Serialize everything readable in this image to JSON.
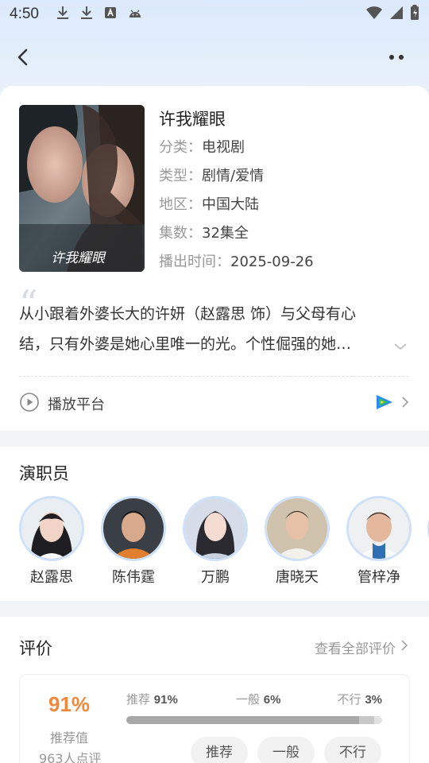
{
  "status_bar": {
    "time": "4:50",
    "icons": [
      "download-icon",
      "download-icon",
      "a-letter-icon",
      "android-icon"
    ],
    "right_icons": [
      "wifi-icon",
      "signal-icon",
      "battery-charging-icon"
    ]
  },
  "nav": {
    "back_icon": "back-chevron-icon",
    "more_icon": "more-dots-icon"
  },
  "show": {
    "title": "许我耀眼",
    "poster_caption": "许我耀眼",
    "fields": [
      {
        "key": "分类：",
        "value": "电视剧"
      },
      {
        "key": "类型：",
        "value": "剧情/爱情"
      },
      {
        "key": "地区：",
        "value": "中国大陆"
      },
      {
        "key": "集数：",
        "value": "32集全"
      },
      {
        "key": "播出时间：",
        "value": "2025-09-26"
      }
    ],
    "quote_mark": "“",
    "description_line1": "从小跟着外婆长大的许妍（赵露思 饰）与父母有心",
    "description_line2": "结，只有外婆是她心里唯一的光。个性倔强的她…",
    "platform_label": "播放平台"
  },
  "cast": {
    "title": "演职员",
    "members": [
      {
        "name": "赵露思"
      },
      {
        "name": "陈伟霆"
      },
      {
        "name": "万鹏"
      },
      {
        "name": "唐晓天"
      },
      {
        "name": "管梓净"
      }
    ]
  },
  "reviews": {
    "title": "评价",
    "see_all": "查看全部评价",
    "percent": "91%",
    "percent_label": "推荐值",
    "count": "963人点评",
    "recommend_label": "推荐",
    "recommend_pct": "91%",
    "recommend_value": 91,
    "average_label": "一般",
    "average_pct": "6%",
    "average_value": 6,
    "bad_label": "不行",
    "bad_pct": "3%",
    "bad_value": 3,
    "buttons": [
      "推荐",
      "一般",
      "不行"
    ]
  },
  "colors": {
    "accent_orange": "#f0883a",
    "avatar_ring": "#cfe1f8",
    "platform_green": "#2fbf5a",
    "platform_blue": "#2a8cf0"
  }
}
